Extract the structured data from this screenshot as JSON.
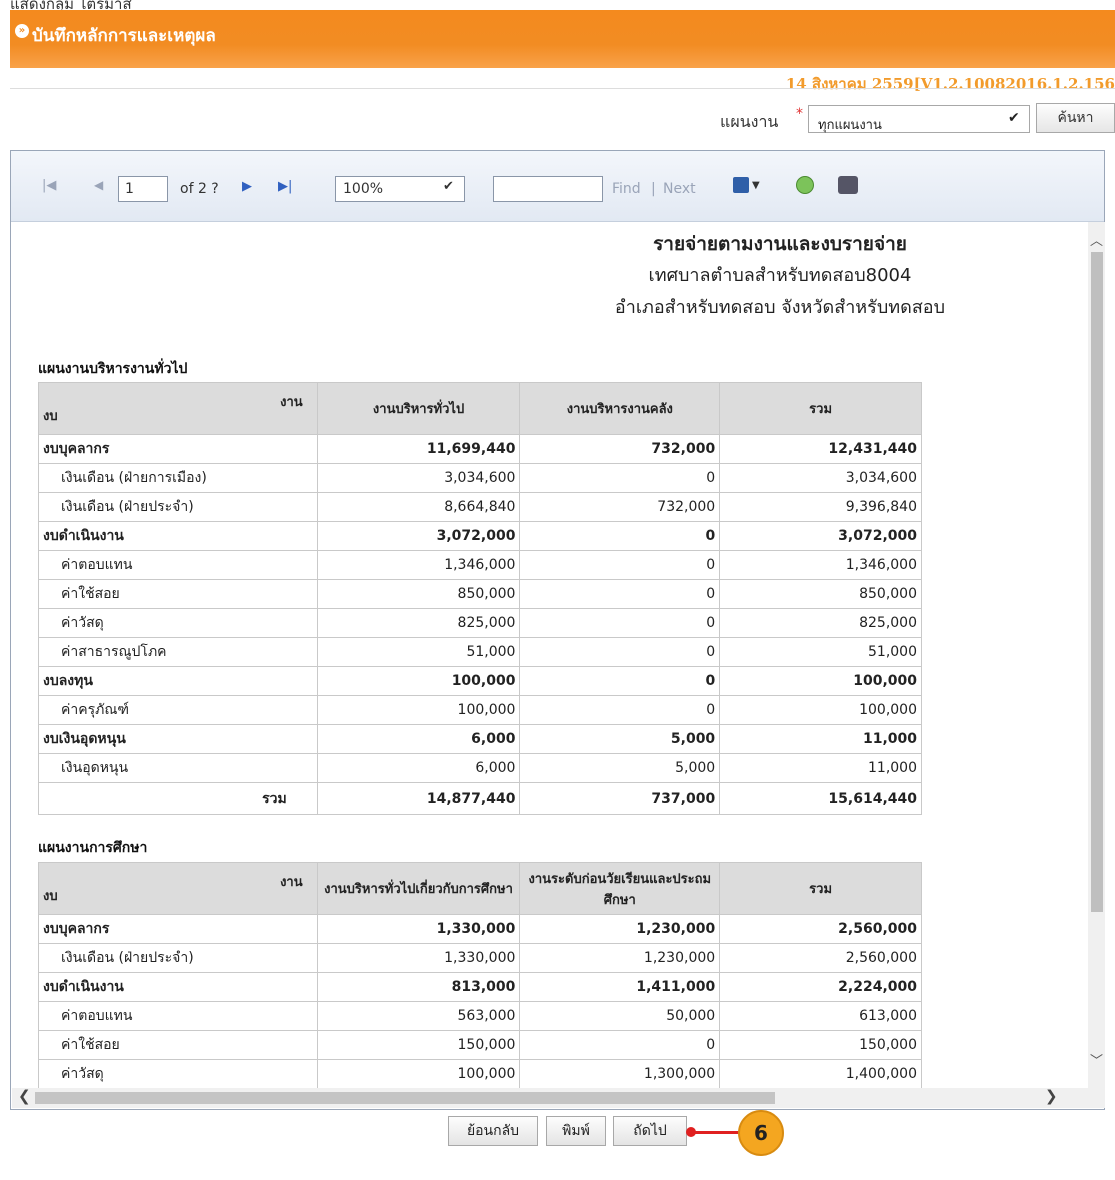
{
  "page": {
    "cut_text": "แสดงกลุ่ม ไตรมาส",
    "header_title": "บันทึกหลักการและเหตุผล",
    "version": "14 สิงหาคม 2559[V1.2.10082016.1.2.156"
  },
  "filter": {
    "plan_label": "แผนงาน",
    "required_mark": "*",
    "plan_value": "ทุกแผนงาน",
    "search_label": "ค้นหา"
  },
  "toolbar": {
    "page_value": "1",
    "page_of": "of 2 ?",
    "zoom_value": "100%",
    "find_value": "",
    "find_label": "Find",
    "separator": "|",
    "next_label": "Next"
  },
  "report": {
    "title": "รายจ่ายตามงานและงบรายจ่าย",
    "subtitle1": "เทศบาลตำบลสำหรับทดสอบ8004",
    "subtitle2": "อำเภอสำหรับทดสอบ จังหวัดสำหรับทดสอบ",
    "section1": {
      "heading": "แผนงานบริหารงานทั่วไป",
      "corner_top": "งาน",
      "corner_bottom": "งบ",
      "columns": [
        "งานบริหารทั่วไป",
        "งานบริหารงานคลัง",
        "รวม"
      ],
      "rows": [
        {
          "label": "งบบุคลากร",
          "group": true,
          "v": [
            "11,699,440",
            "732,000",
            "12,431,440"
          ]
        },
        {
          "label": "เงินเดือน (ฝ่ายการเมือง)",
          "group": false,
          "v": [
            "3,034,600",
            "0",
            "3,034,600"
          ]
        },
        {
          "label": "เงินเดือน (ฝ่ายประจำ)",
          "group": false,
          "v": [
            "8,664,840",
            "732,000",
            "9,396,840"
          ]
        },
        {
          "label": "งบดำเนินงาน",
          "group": true,
          "v": [
            "3,072,000",
            "0",
            "3,072,000"
          ]
        },
        {
          "label": "ค่าตอบแทน",
          "group": false,
          "v": [
            "1,346,000",
            "0",
            "1,346,000"
          ]
        },
        {
          "label": "ค่าใช้สอย",
          "group": false,
          "v": [
            "850,000",
            "0",
            "850,000"
          ]
        },
        {
          "label": "ค่าวัสดุ",
          "group": false,
          "v": [
            "825,000",
            "0",
            "825,000"
          ]
        },
        {
          "label": "ค่าสาธารณูปโภค",
          "group": false,
          "v": [
            "51,000",
            "0",
            "51,000"
          ]
        },
        {
          "label": "งบลงทุน",
          "group": true,
          "v": [
            "100,000",
            "0",
            "100,000"
          ]
        },
        {
          "label": "ค่าครุภัณฑ์",
          "group": false,
          "v": [
            "100,000",
            "0",
            "100,000"
          ]
        },
        {
          "label": "งบเงินอุดหนุน",
          "group": true,
          "v": [
            "6,000",
            "5,000",
            "11,000"
          ]
        },
        {
          "label": "เงินอุดหนุน",
          "group": false,
          "v": [
            "6,000",
            "5,000",
            "11,000"
          ]
        }
      ],
      "total_label": "รวม",
      "total": [
        "14,877,440",
        "737,000",
        "15,614,440"
      ]
    },
    "section2": {
      "heading": "แผนงานการศึกษา",
      "corner_top": "งาน",
      "corner_bottom": "งบ",
      "columns": [
        "งานบริหารทั่วไปเกี่ยวกับการศึกษา",
        "งานระดับก่อนวัยเรียนและประถมศึกษา",
        "รวม"
      ],
      "rows": [
        {
          "label": "งบบุคลากร",
          "group": true,
          "v": [
            "1,330,000",
            "1,230,000",
            "2,560,000"
          ]
        },
        {
          "label": "เงินเดือน (ฝ่ายประจำ)",
          "group": false,
          "v": [
            "1,330,000",
            "1,230,000",
            "2,560,000"
          ]
        },
        {
          "label": "งบดำเนินงาน",
          "group": true,
          "v": [
            "813,000",
            "1,411,000",
            "2,224,000"
          ]
        },
        {
          "label": "ค่าตอบแทน",
          "group": false,
          "v": [
            "563,000",
            "50,000",
            "613,000"
          ]
        },
        {
          "label": "ค่าใช้สอย",
          "group": false,
          "v": [
            "150,000",
            "0",
            "150,000"
          ]
        },
        {
          "label": "ค่าวัสดุ",
          "group": false,
          "v": [
            "100,000",
            "1,300,000",
            "1,400,000"
          ]
        }
      ]
    }
  },
  "buttons": {
    "back": "ย้อนกลับ",
    "print": "พิมพ์",
    "next": "ถัดไป"
  },
  "callout": "6"
}
